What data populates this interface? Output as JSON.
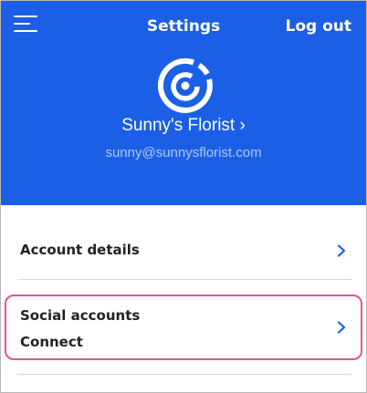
{
  "header": {
    "title": "Settings",
    "logout_label": "Log out",
    "account_name": "Sunny's Florist",
    "account_chevron": "›",
    "email": "sunny@sunnysflorist.com"
  },
  "rows": [
    {
      "label": "Account details"
    },
    {
      "label": "Social accounts",
      "sublabel": "Connect"
    }
  ],
  "colors": {
    "header_bg": "#1a5fe6",
    "chevron": "#1a5fe6",
    "highlight_border": "#e0559a"
  },
  "icons": [
    "menu-icon",
    "app-logo-icon",
    "chevron-right-icon"
  ]
}
